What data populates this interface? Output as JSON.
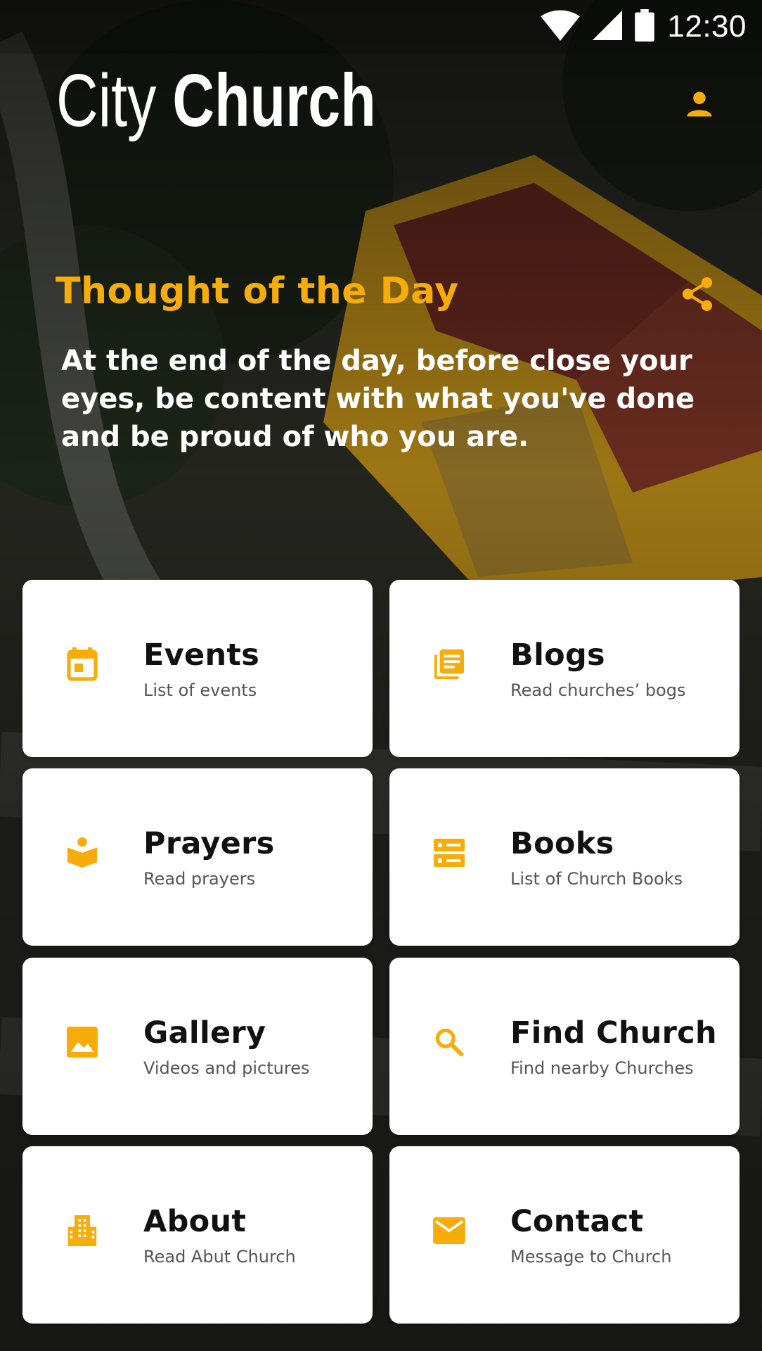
{
  "colors": {
    "accent": "#f7ac0a",
    "card_bg": "#ffffff",
    "title_text": "#111111",
    "subtitle_text": "#555555"
  },
  "status_bar": {
    "time": "12:30",
    "icons": [
      "wifi-icon",
      "signal-icon",
      "battery-icon"
    ]
  },
  "header": {
    "title_light": "City",
    "title_bold": "Church",
    "profile_icon": "person-icon"
  },
  "thought": {
    "heading": "Thought of the Day",
    "share_icon": "share-icon",
    "text": "At the end of the day, before close your eyes, be content with what you've done and be proud of who you are."
  },
  "menu": [
    {
      "title": "Events",
      "subtitle": "List of events",
      "icon": "calendar-icon"
    },
    {
      "title": "Blogs",
      "subtitle": "Read churches’ bogs",
      "icon": "library-books-icon"
    },
    {
      "title": "Prayers",
      "subtitle": "Read prayers",
      "icon": "open-book-person-icon"
    },
    {
      "title": "Books",
      "subtitle": "List of Church Books",
      "icon": "storage-icon"
    },
    {
      "title": "Gallery",
      "subtitle": "Videos and pictures",
      "icon": "image-icon"
    },
    {
      "title": "Find Church",
      "subtitle": "Find nearby Churches",
      "icon": "search-icon"
    },
    {
      "title": "About",
      "subtitle": "Read Abut Church",
      "icon": "building-icon"
    },
    {
      "title": "Contact",
      "subtitle": "Message to Church",
      "icon": "mail-icon"
    }
  ]
}
